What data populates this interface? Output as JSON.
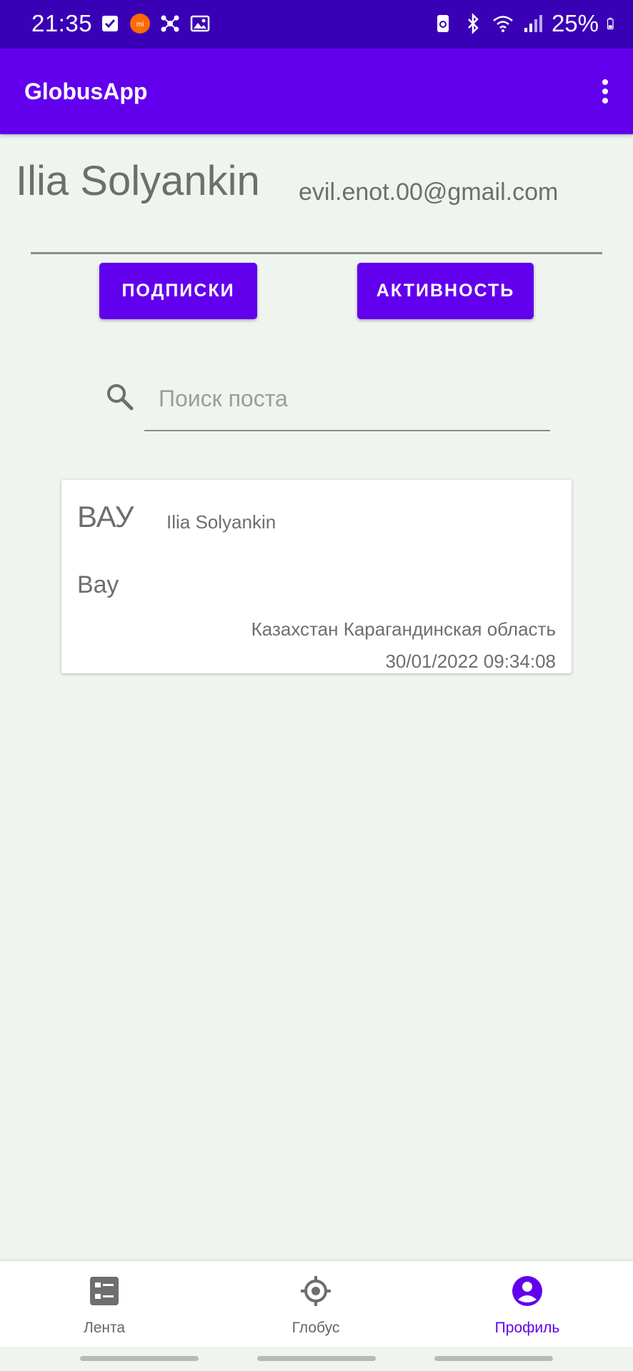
{
  "status_bar": {
    "time": "21:35",
    "battery": "25%",
    "icons_left": [
      "check-icon",
      "mi-icon",
      "network-icon",
      "image-icon"
    ],
    "icons_right": [
      "recycle-icon",
      "bluetooth-icon",
      "wifi-icon",
      "signal-icon",
      "battery-icon"
    ]
  },
  "app_bar": {
    "title": "GlobusApp"
  },
  "profile": {
    "name": "Ilia Solyankin",
    "email": "evil.enot.00@gmail.com",
    "subscriptions_label": "ПОДПИСКИ",
    "activity_label": "АКТИВНОСТЬ"
  },
  "search": {
    "placeholder": "Поиск поста",
    "value": ""
  },
  "posts": [
    {
      "title": "ВАУ",
      "author": "Ilia Solyankin",
      "body": "Вау",
      "location": "Казахстан Карагандинская область",
      "datetime": "30/01/2022 09:34:08"
    }
  ],
  "bottom_nav": {
    "items": [
      {
        "label": "Лента",
        "icon": "feed-icon",
        "active": false
      },
      {
        "label": "Глобус",
        "icon": "globe-icon",
        "active": false
      },
      {
        "label": "Профиль",
        "icon": "profile-icon",
        "active": true
      }
    ]
  },
  "colors": {
    "status_bar": "#3a00b5",
    "primary": "#6200ee",
    "background": "#f0f4ef",
    "text_gray": "#6c6f6c"
  }
}
